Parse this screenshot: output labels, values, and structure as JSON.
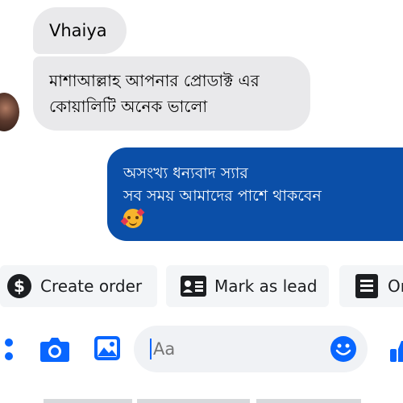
{
  "messages": {
    "incoming": [
      {
        "text": "Vhaiya"
      },
      {
        "line1": "মাশাআল্লাহ আপনার প্রোডাক্ট এর",
        "line2": "কোয়ালিটি অনেক ভালো"
      }
    ],
    "outgoing": {
      "line1": "অসংখ্য ধন্যবাদ স্যার",
      "line2": "সব সময়  আমাদের পাশে থাকবেন",
      "emoji": "smiling-face-with-hearts"
    }
  },
  "quick_actions": [
    {
      "label": "Create order",
      "icon": "dollar-icon"
    },
    {
      "label": "Mark as lead",
      "icon": "contact-card-icon"
    },
    {
      "label": "Or",
      "icon": "list-icon"
    }
  ],
  "composer": {
    "placeholder": "Aa"
  },
  "colors": {
    "accent": "#0866ff",
    "outgoing_bubble": "#0b4fa8",
    "incoming_bubble": "#e9e9eb"
  }
}
